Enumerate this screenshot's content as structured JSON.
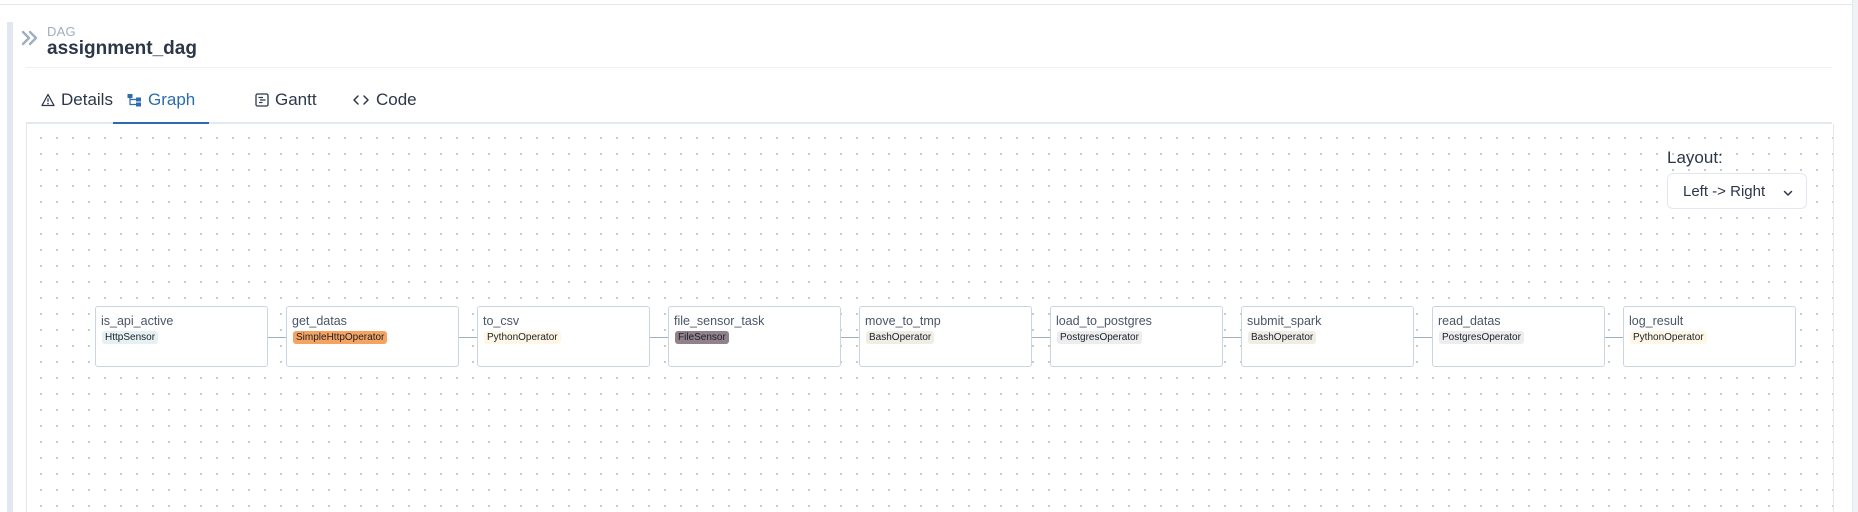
{
  "header": {
    "kicker": "DAG",
    "dag_id": "assignment_dag",
    "collapse_icon": "double-chevron-right-icon"
  },
  "tabs": [
    {
      "label": "Details",
      "icon": "warning-triangle-icon",
      "active": false
    },
    {
      "label": "Graph",
      "icon": "graph-icon",
      "active": true
    },
    {
      "label": "Gantt",
      "icon": "gantt-icon",
      "active": false
    },
    {
      "label": "Code",
      "icon": "code-icon",
      "active": false
    }
  ],
  "layout": {
    "label": "Layout:",
    "selected": "Left -> Right",
    "icon": "chevron-down-icon"
  },
  "nodes": [
    {
      "task_id": "is_api_active",
      "operator": "HttpSensor",
      "operator_color": "#e6f1f2"
    },
    {
      "task_id": "get_datas",
      "operator": "SimpleHttpOperator",
      "operator_color": "#f4a460"
    },
    {
      "task_id": "to_csv",
      "operator": "PythonOperator",
      "operator_color": "#fff7e6"
    },
    {
      "task_id": "file_sensor_task",
      "operator": "FileSensor",
      "operator_color": "#91818a"
    },
    {
      "task_id": "move_to_tmp",
      "operator": "BashOperator",
      "operator_color": "#f0ede4"
    },
    {
      "task_id": "load_to_postgres",
      "operator": "PostgresOperator",
      "operator_color": "#ededed"
    },
    {
      "task_id": "submit_spark",
      "operator": "BashOperator",
      "operator_color": "#f0ede4"
    },
    {
      "task_id": "read_datas",
      "operator": "PostgresOperator",
      "operator_color": "#ededed"
    },
    {
      "task_id": "log_result",
      "operator": "PythonOperator",
      "operator_color": "#fff7e6"
    }
  ],
  "colors": {
    "accent": "#2b6cb0",
    "text": "#2d3748",
    "muted": "#a0aec0",
    "node_border": "#cbd5e0",
    "edge": "#a0aec0"
  }
}
